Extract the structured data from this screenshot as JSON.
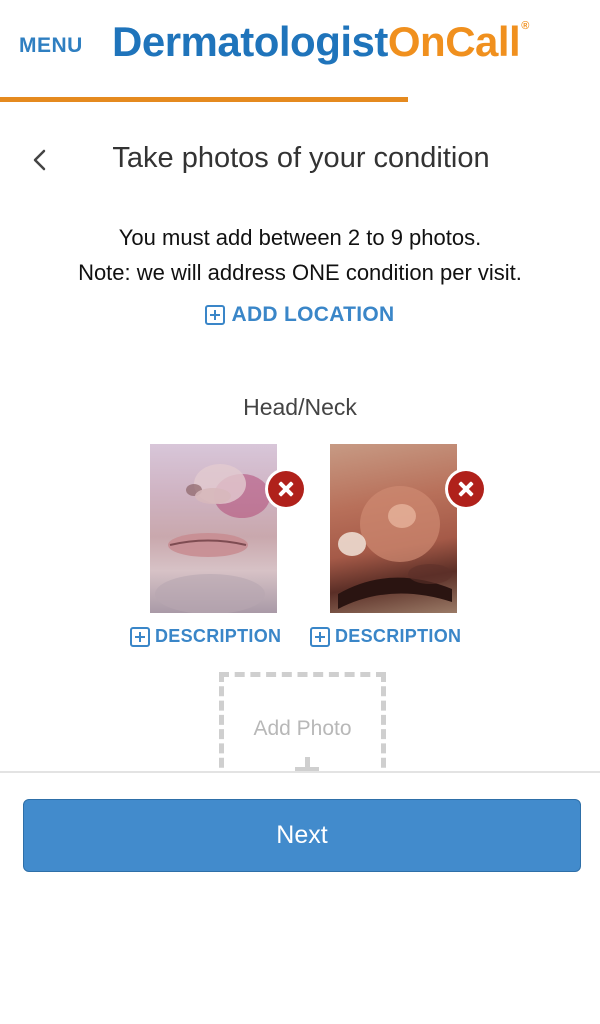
{
  "header": {
    "menu_label": "MENU",
    "logo_part1": "Dermatologist",
    "logo_part2": "OnCall",
    "logo_mark": "®",
    "brand_colors": {
      "blue": "#1f74bb",
      "orange": "#f0901e"
    },
    "progress_percent": 68
  },
  "page": {
    "back_icon": "chevron-left-icon",
    "title": "Take photos of your condition",
    "instruction_line1": "You must add between 2 to 9 photos.",
    "instruction_line2": "Note: we will address ONE condition per visit.",
    "add_location_label": "ADD LOCATION"
  },
  "location": {
    "label": "Head/Neck",
    "photos": [
      {
        "description_label": "DESCRIPTION",
        "remove_icon": "close-icon"
      },
      {
        "description_label": "DESCRIPTION",
        "remove_icon": "close-icon"
      }
    ],
    "add_photo_label": "Add Photo"
  },
  "footer": {
    "next_label": "Next",
    "accent_color": "#428bcc"
  }
}
